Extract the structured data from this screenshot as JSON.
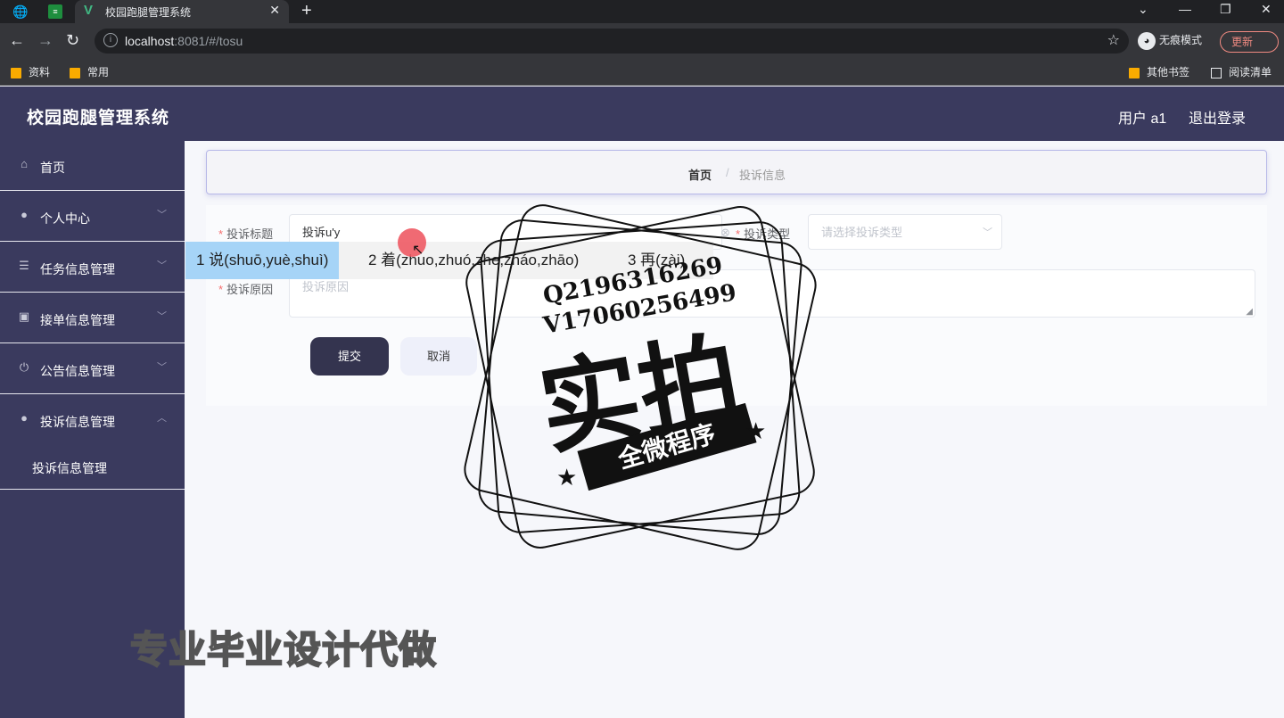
{
  "browser": {
    "tab_title": "校园跑腿管理系统",
    "url_host": "localhost",
    "url_rest": ":8081/#/tosu",
    "incognito_label": "无痕模式",
    "update_label": "更新",
    "bookmarks": [
      "资料",
      "常用"
    ],
    "bookmarks_right": [
      "其他书签",
      "阅读清单"
    ]
  },
  "header": {
    "title": "校园跑腿管理系统",
    "user": "用户 a1",
    "logout": "退出登录"
  },
  "sidebar": {
    "items": [
      {
        "label": "首页",
        "icon": "home-icon"
      },
      {
        "label": "个人中心",
        "icon": "user-icon"
      },
      {
        "label": "任务信息管理",
        "icon": "sliders-icon"
      },
      {
        "label": "接单信息管理",
        "icon": "clipboard-icon"
      },
      {
        "label": "公告信息管理",
        "icon": "power-icon"
      },
      {
        "label": "投诉信息管理",
        "icon": "user-icon"
      }
    ],
    "sub_item": "投诉信息管理"
  },
  "breadcrumb": {
    "home": "首页",
    "sep": "/",
    "current": "投诉信息"
  },
  "form": {
    "title_label": "投诉标题",
    "title_value": "投诉u'y",
    "type_label": "投诉类型",
    "type_placeholder": "请选择投诉类型",
    "reason_label": "投诉原因",
    "reason_placeholder": "投诉原因",
    "submit": "提交",
    "cancel": "取消"
  },
  "ime": {
    "candidates": [
      "1 说(shuō,yuè,shuì)",
      "2 着(zhuo,zhuó,zhe,zháo,zhāo)",
      "3 再(zài)"
    ]
  },
  "watermark": {
    "q": "Q2196316269",
    "v": "V17060256499",
    "big": "实拍",
    "ribbon": "全微程序",
    "bottom": "专业毕业设计代做"
  }
}
